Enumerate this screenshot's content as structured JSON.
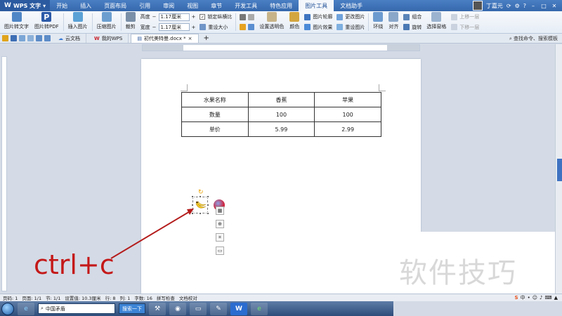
{
  "menubar": {
    "app_name": "WPS 文字",
    "items": [
      "开始",
      "插入",
      "页面布局",
      "引用",
      "审阅",
      "视图",
      "章节",
      "开发工具",
      "特色应用",
      "图片工具",
      "文档助手"
    ],
    "active_index": 9,
    "user_name": "丁嘉元"
  },
  "ribbon": {
    "pic_to_text": "图片转文字",
    "pic_to_pdf": "图片转PDF",
    "insert_pic": "插入图片",
    "compress_pic": "压缩图片",
    "crop": "裁剪",
    "height_label": "高度",
    "height_value": "1.17厘米",
    "width_label": "宽度",
    "width_value": "1.17厘米",
    "lock_ratio": "锁定纵横比",
    "reset_size": "重设大小",
    "set_transparent": "设置透明色",
    "color": "颜色",
    "pic_outline": "图片轮廓",
    "change_pic": "更改图片",
    "pic_effect": "图片效果",
    "reset_pic": "重设图片",
    "wrap": "环绕",
    "align": "对齐",
    "group": "组合",
    "rotate": "旋转",
    "select_pane": "选择窗格",
    "prev_layer": "上移一层",
    "next_layer": "下移一层"
  },
  "tabs": {
    "cloud_docs": "云文档",
    "my_wps": "我的WPS",
    "doc_name": "初代美特曼.docx *",
    "search_command": "查找命令、搜索模板"
  },
  "table": {
    "rows": [
      [
        "水果名称",
        "香蕉",
        "苹果"
      ],
      [
        "数量",
        "100",
        "100"
      ],
      [
        "单价",
        "5.99",
        "2.99"
      ]
    ]
  },
  "annotation": {
    "text": "ctrl+c",
    "watermark": "软件技巧"
  },
  "statusbar": {
    "page_num": "页码: 1",
    "pages": "页面: 1/1",
    "section": "节: 1/1",
    "setting": "设置值: 10.3厘米",
    "row": "行: 8",
    "col": "列: 1",
    "words": "字数: 16",
    "spell": "拼写检查",
    "proof": "文档校对"
  },
  "taskbar": {
    "search_text": "中国矛盾",
    "search_button": "搜索一下"
  },
  "colors": {
    "accent": "#3568ad",
    "annotation": "#c41818"
  }
}
